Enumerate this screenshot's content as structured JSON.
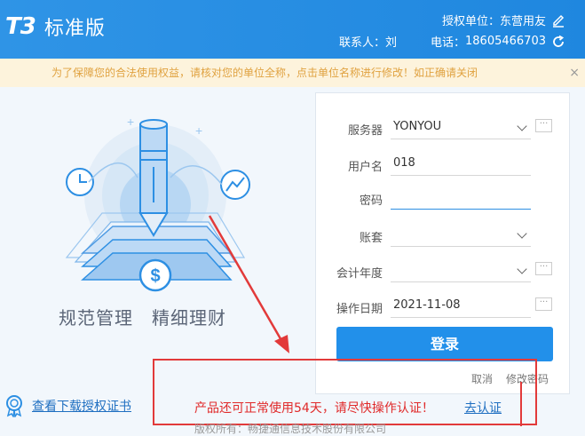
{
  "header": {
    "logo_mark": "T3",
    "logo_name": "标准版",
    "auth_unit_label": "授权单位：东营用友",
    "contact_label": "联系人：刘",
    "phone_label": "电话：",
    "phone_value": "18605466703"
  },
  "notice": {
    "text": "为了保障您的合法使用权益，请核对您的单位全称，点击单位名称进行修改！如正确请关闭",
    "close": "×"
  },
  "slogan": "规范管理　精细理财",
  "illustration": {
    "currency_glyph": "$"
  },
  "form": {
    "server_label": "服务器",
    "server_value": "YONYOU",
    "user_label": "用户名",
    "user_value": "018",
    "password_label": "密码",
    "password_value": "",
    "account_label": "账套",
    "account_value": "",
    "year_label": "会计年度",
    "year_value": "",
    "date_label": "操作日期",
    "date_value": "2021-11-08",
    "more_glyph": "···",
    "login_label": "登录",
    "cancel_label": "取消",
    "change_password_label": "修改密码"
  },
  "footer": {
    "download_cert_label": "查看下载授权证书",
    "warning_text": "产品还可正常使用54天，请尽快操作认证！",
    "certify_link": "去认证",
    "copyright": "版权所有：畅捷通信息技术股份有限公司"
  },
  "colors": {
    "header_bg": "#2290ea",
    "warning_red": "#e02a2a",
    "link_blue": "#1f6fc1",
    "notice_text": "#e0a240"
  }
}
